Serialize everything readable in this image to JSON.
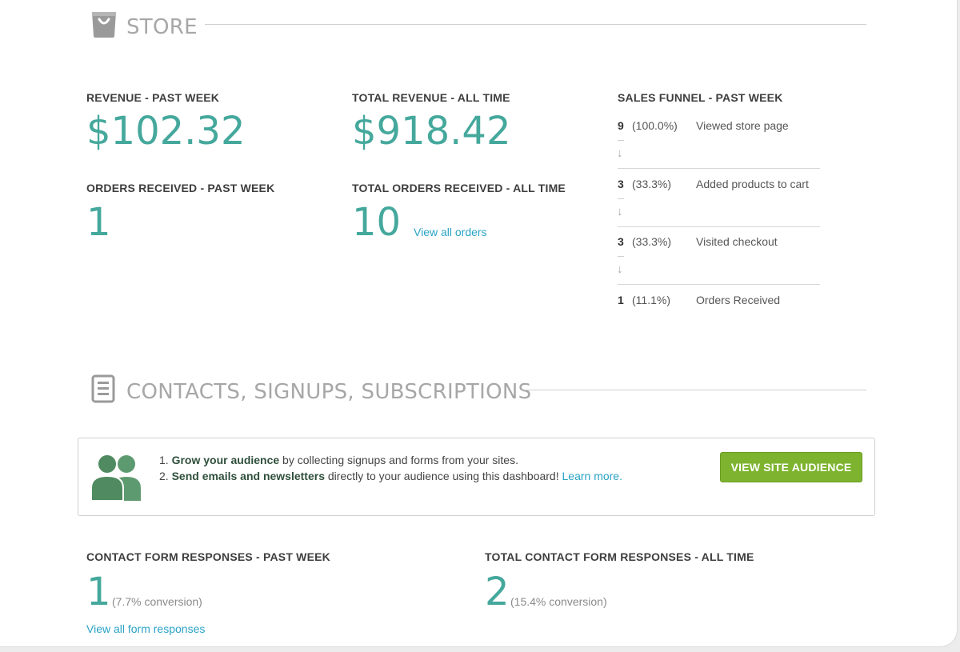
{
  "store": {
    "title": "STORE",
    "revenue_week": {
      "label": "REVENUE - PAST WEEK",
      "value": "$102.32"
    },
    "revenue_all": {
      "label": "TOTAL REVENUE - ALL TIME",
      "value": "$918.42"
    },
    "orders_week": {
      "label": "ORDERS RECEIVED - PAST WEEK",
      "value": "1"
    },
    "orders_all": {
      "label": "TOTAL ORDERS RECEIVED - ALL TIME",
      "value": "10",
      "link": "View all orders"
    },
    "funnel": {
      "label": "SALES FUNNEL - PAST WEEK",
      "steps": [
        {
          "count": "9",
          "percent": "(100.0%)",
          "description": "Viewed store page"
        },
        {
          "count": "3",
          "percent": "(33.3%)",
          "description": "Added products to cart"
        },
        {
          "count": "3",
          "percent": "(33.3%)",
          "description": "Visited checkout"
        },
        {
          "count": "1",
          "percent": "(11.1%)",
          "description": "Orders Received"
        }
      ],
      "arrow": "↓"
    }
  },
  "contacts": {
    "title": "CONTACTS, SIGNUPS, SUBSCRIPTIONS",
    "audience": {
      "line1_num": "1.",
      "line1_bold": "Grow your audience",
      "line1_rest": " by collecting signups and forms from your sites.",
      "line2_num": "2.",
      "line2_bold": "Send emails and newsletters",
      "line2_rest": " directly to your audience using this dashboard!",
      "learn_more": "Learn more.",
      "button": "VIEW SITE AUDIENCE"
    },
    "responses_week": {
      "label": "CONTACT FORM RESPONSES - PAST WEEK",
      "value": "1",
      "conversion": "(7.7% conversion)",
      "link": "View all form responses"
    },
    "responses_all": {
      "label": "TOTAL CONTACT FORM RESPONSES - ALL TIME",
      "value": "2",
      "conversion": "(15.4% conversion)"
    }
  },
  "colors": {
    "accent": "#45a89c",
    "link": "#2aa3c6",
    "button": "#7db32e",
    "people_icon": "#5e9a70"
  },
  "icons": {
    "store": "shopping-bag-icon",
    "contacts": "document-list-icon",
    "audience": "people-icon"
  }
}
